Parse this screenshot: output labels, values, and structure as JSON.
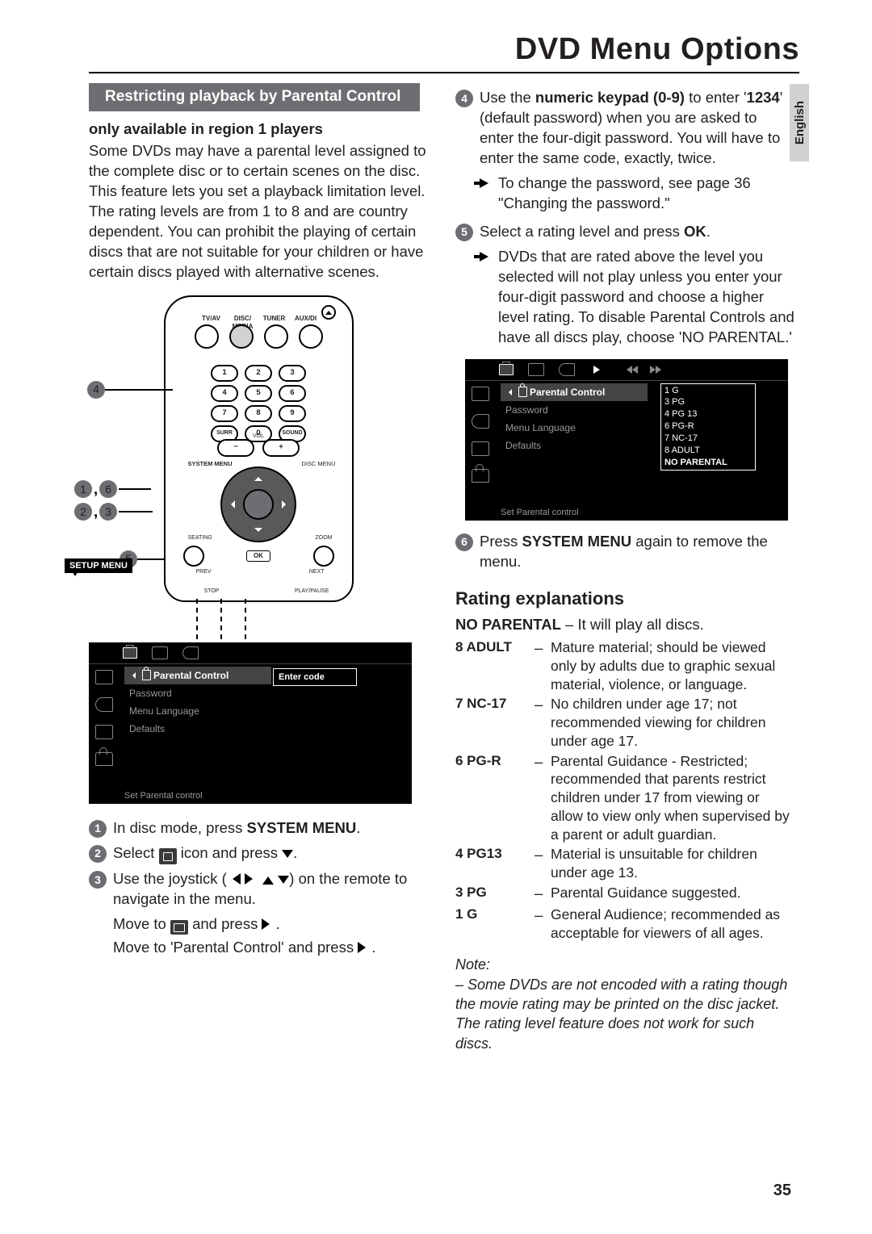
{
  "title": "DVD Menu Options",
  "language_tab": "English",
  "page_number": "35",
  "left": {
    "section_heading": "Restricting playback by Parental Control",
    "region_note": "only available in region 1 players",
    "intro": "Some DVDs may have a parental level assigned to the complete disc or to certain scenes on the disc. This feature lets you set a playback limitation level. The rating levels are from 1 to 8 and are country dependent. You can prohibit the playing of certain discs that are not suitable for your children or have certain discs played with alternative scenes.",
    "remote": {
      "top_labels": [
        "TV/AV",
        "DISC/\nMEDIA",
        "TUNER",
        "AUX/DI"
      ],
      "keys_row1": [
        "1",
        "2",
        "3"
      ],
      "keys_row2": [
        "4",
        "5",
        "6"
      ],
      "keys_row3": [
        "7",
        "8",
        "9"
      ],
      "keys_row4": [
        "SURR",
        "0",
        "SOUND"
      ],
      "vol_label": "VOL",
      "sys_menu": "SYSTEM MENU",
      "disc_menu": "DISC MENU",
      "ok": "OK",
      "bottom_lbls": {
        "prev": "PREV",
        "next": "NEXT",
        "stop": "STOP",
        "play": "PLAY/PAUSE",
        "seating": "SEATING",
        "zoom": "ZOOM"
      },
      "callouts": {
        "c4": "4",
        "c16": "1, 6",
        "c23": "2, 3",
        "c5": "5"
      },
      "setup_menu": "SETUP MENU"
    },
    "osd": {
      "menu_items": [
        "Parental Control",
        "Password",
        "Menu Language",
        "Defaults"
      ],
      "right_label": "Enter code",
      "footer": "Set Parental control"
    },
    "steps": {
      "s1_a": "In disc mode, press ",
      "s1_b": "SYSTEM MENU",
      "s1_c": ".",
      "s2_a": "Select ",
      "s2_b": " icon and press ",
      "s2_c": ".",
      "s3_a": "Use the joystick (",
      "s3_b": ") on the remote to navigate in the menu.",
      "s3_move1_a": "Move to ",
      "s3_move1_b": " and press ",
      "s3_move1_c": ".",
      "s3_move2_a": "Move to '",
      "s3_move2_b": "Parental Control",
      "s3_move2_c": "' and press ",
      "s3_move2_d": "."
    }
  },
  "right": {
    "steps": {
      "s4_a": "Use the ",
      "s4_b": "numeric keypad (0-9)",
      "s4_c": " to enter '",
      "s4_d": "1234",
      "s4_e": "' (default password) when you are asked to enter the four-digit password. You will have to enter the same code, exactly, twice.",
      "s4_arrow_a": "To change the password, see page 36 \"",
      "s4_arrow_b": "Changing the password",
      "s4_arrow_c": ".\"",
      "s5_a": "Select a rating level and press ",
      "s5_b": "OK",
      "s5_c": ".",
      "s5_arrow_a": "DVDs that are rated above the level you selected will not play unless you enter your four-digit password and choose a higher level rating. To disable Parental Controls and have all discs play, choose '",
      "s5_arrow_b": "NO PARENTAL",
      "s5_arrow_c": ".'",
      "s6_a": "Press ",
      "s6_b": "SYSTEM MENU",
      "s6_c": " again to remove the menu."
    },
    "osd": {
      "menu_items": [
        "Parental Control",
        "Password",
        "Menu Language",
        "Defaults"
      ],
      "ratings": [
        "1 G",
        "3 PG",
        "4 PG 13",
        "6 PG-R",
        "7 NC-17",
        "8 ADULT",
        "NO PARENTAL"
      ],
      "footer": "Set Parental control"
    },
    "ratings_heading": "Rating explanations",
    "no_parental_a": "NO PARENTAL",
    "no_parental_b": " – It will play all discs.",
    "ratings": [
      {
        "lbl": "8 ADULT",
        "desc": "Mature material; should be viewed only by adults due to graphic sexual material, violence, or language."
      },
      {
        "lbl": "7 NC-17",
        "desc": "No children under age 17; not recommended viewing for children under age 17."
      },
      {
        "lbl": "6 PG-R",
        "desc": "Parental Guidance - Restricted; recommended that parents restrict children under 17 from viewing or allow to view only when supervised by a parent or adult guardian."
      },
      {
        "lbl": "4 PG13",
        "desc": "Material is unsuitable for children under age 13."
      },
      {
        "lbl": "3 PG",
        "desc": "Parental Guidance suggested."
      },
      {
        "lbl": "1 G",
        "desc": "General Audience; recommended as acceptable for viewers of all ages."
      }
    ],
    "note_label": "Note:",
    "note_body": "– Some DVDs are not encoded with a rating though the movie rating may be printed on the disc jacket. The rating level feature does not work for such discs."
  }
}
